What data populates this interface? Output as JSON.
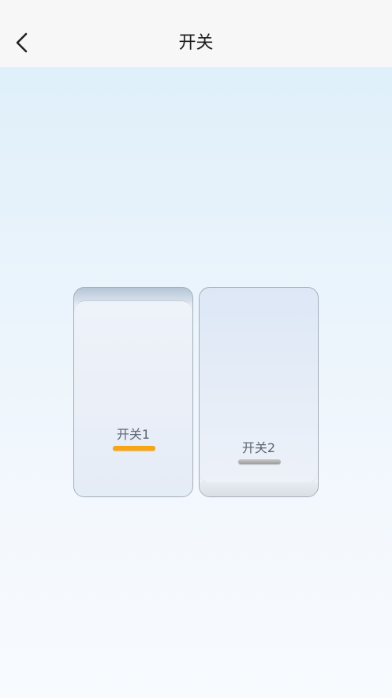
{
  "header": {
    "title": "开关",
    "back_icon": "chevron-left-icon"
  },
  "switches": [
    {
      "label": "开关1",
      "state": "on",
      "indicator_color": "#f7a512"
    },
    {
      "label": "开关2",
      "state": "off",
      "indicator_color": "#b0b0b0"
    }
  ],
  "colors": {
    "background_top": "#dceef9",
    "background_bottom": "#f8fbfe",
    "nav_bar": "#f7f7f7",
    "indicator_on": "#f7a512",
    "indicator_off": "#b0b0b0"
  }
}
